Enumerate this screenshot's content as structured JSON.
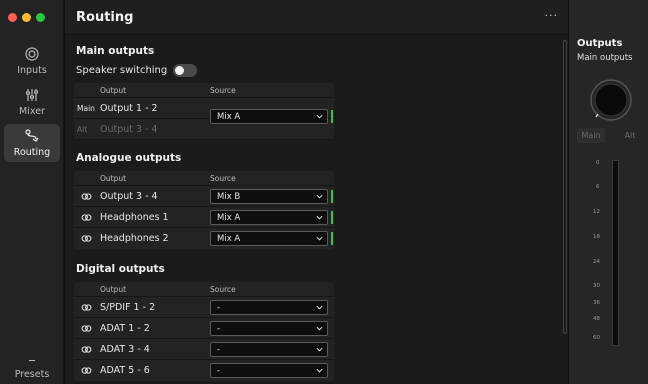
{
  "window": {
    "traffic_lights": [
      "#ff5f57",
      "#febc2e",
      "#28c840"
    ]
  },
  "sidebar": {
    "items": [
      {
        "label": "Inputs",
        "icon": "inputs-icon"
      },
      {
        "label": "Mixer",
        "icon": "mixer-icon"
      },
      {
        "label": "Routing",
        "icon": "routing-icon",
        "active": true
      }
    ],
    "presets": "Presets"
  },
  "header": {
    "title": "Routing",
    "more": "···"
  },
  "main_outputs": {
    "title": "Main outputs",
    "speaker_switching": "Speaker switching",
    "columns": {
      "output": "Output",
      "source": "Source"
    },
    "rows": [
      {
        "tag": "Main",
        "name": "Output 1 - 2"
      },
      {
        "tag": "Alt",
        "name": "Output 3 - 4"
      }
    ],
    "source": "Mix A"
  },
  "analogue_outputs": {
    "title": "Analogue outputs",
    "columns": {
      "output": "Output",
      "source": "Source"
    },
    "rows": [
      {
        "name": "Output 3 - 4",
        "source": "Mix B"
      },
      {
        "name": "Headphones 1",
        "source": "Mix A"
      },
      {
        "name": "Headphones 2",
        "source": "Mix A"
      }
    ]
  },
  "digital_outputs": {
    "title": "Digital outputs",
    "columns": {
      "output": "Output",
      "source": "Source"
    },
    "rows": [
      {
        "name": "S/PDIF 1 - 2",
        "source": "-"
      },
      {
        "name": "ADAT 1 - 2",
        "source": "-"
      },
      {
        "name": "ADAT 3 - 4",
        "source": "-"
      },
      {
        "name": "ADAT 5 - 6",
        "source": "-"
      }
    ]
  },
  "right_panel": {
    "title": "Outputs",
    "subtitle": "Main outputs",
    "main_label": "Main",
    "alt_label": "Alt",
    "scale": [
      "0",
      "6",
      "12",
      "18",
      "24",
      "30",
      "36",
      "48",
      "60"
    ]
  },
  "colors": {
    "meter_green": "#3ac15a"
  }
}
